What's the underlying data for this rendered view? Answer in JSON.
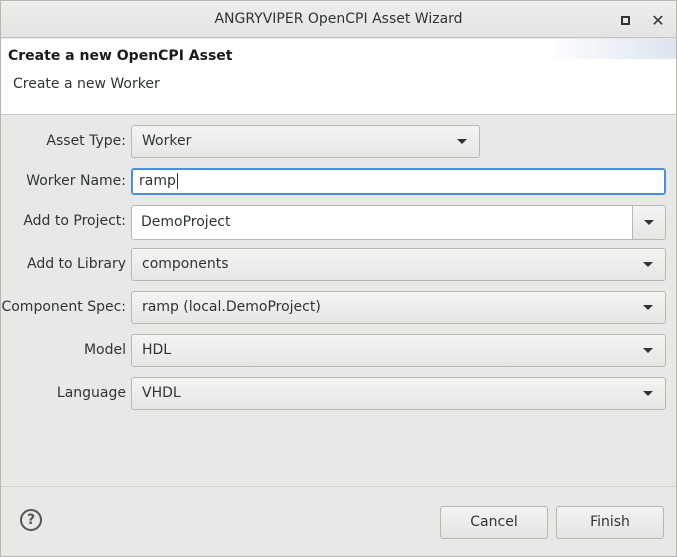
{
  "window": {
    "title": "ANGRYVIPER OpenCPI Asset Wizard"
  },
  "banner": {
    "title": "Create a new OpenCPI Asset",
    "subtitle": "Create a new Worker"
  },
  "form": {
    "asset_type": {
      "label": "Asset Type:",
      "value": "Worker"
    },
    "worker_name": {
      "label": "Worker Name:",
      "value": "ramp"
    },
    "add_to_project": {
      "label": "Add to Project:",
      "value": "DemoProject"
    },
    "add_to_library": {
      "label": "Add to Library",
      "value": "components"
    },
    "component_spec": {
      "label": "Component Spec:",
      "value": "ramp (local.DemoProject)"
    },
    "model": {
      "label": "Model",
      "value": "HDL"
    },
    "language": {
      "label": "Language",
      "value": "VHDL"
    }
  },
  "footer": {
    "help_glyph": "?",
    "cancel_label": "Cancel",
    "finish_label": "Finish"
  },
  "icons": {
    "maximize": "maximize-icon",
    "close": "close-icon",
    "dropdown": "chevron-down-icon",
    "help": "help-icon"
  },
  "colors": {
    "focus_border": "#4a90d9",
    "window_bg": "#e8e8e7",
    "banner_bg": "#ffffff"
  }
}
